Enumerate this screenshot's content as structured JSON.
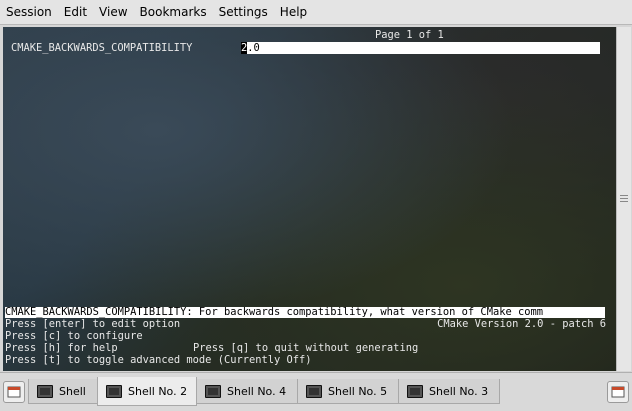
{
  "menu": {
    "items": [
      "Session",
      "Edit",
      "View",
      "Bookmarks",
      "Settings",
      "Help"
    ]
  },
  "terminal": {
    "page_info": "Page 1 of 1",
    "variable_name": "CMAKE_BACKWARDS_COMPATIBILITY",
    "value_first": "2",
    "value_rest": ".0",
    "help_text": "CMAKE_BACKWARDS_COMPATIBILITY: For backwards compatibility, what version of CMake comm",
    "line1_left": "Press [enter] to edit option",
    "line1_right": "CMake Version 2.0 - patch 6",
    "line2": "Press [c] to configure",
    "line3_left": "Press [h] for help",
    "line3_right": "Press [q] to quit without generating",
    "line4": "Press [t] to toggle advanced mode (Currently Off)"
  },
  "tabs": [
    {
      "label": "Shell",
      "active": false
    },
    {
      "label": "Shell No. 2",
      "active": true
    },
    {
      "label": "Shell No. 4",
      "active": false
    },
    {
      "label": "Shell No. 5",
      "active": false
    },
    {
      "label": "Shell No. 3",
      "active": false
    }
  ],
  "icons": {
    "new_session": "new-session-icon",
    "close_session": "close-session-icon",
    "tab_terminal": "terminal-icon"
  }
}
